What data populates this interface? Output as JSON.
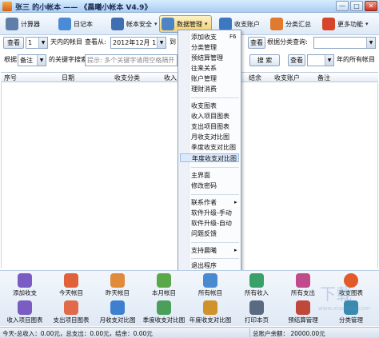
{
  "window": {
    "title": "张三 的小帐本 —— 《晨曦小帐本 V4.9》",
    "controls": [
      "—",
      "□",
      "✕"
    ]
  },
  "toolbar": {
    "items": [
      {
        "label": "计算器",
        "icon": "calculator-icon",
        "color": "#5f7fa8"
      },
      {
        "label": "日记本",
        "icon": "notebook-icon",
        "color": "#4b8bd6"
      },
      {
        "label": "帐本安全",
        "icon": "shield-icon",
        "color": "#3f6fb0"
      },
      {
        "label": "数据管理",
        "icon": "database-icon",
        "color": "#4d84c8"
      },
      {
        "label": "收支账户",
        "icon": "account-icon",
        "color": "#3c78c0"
      },
      {
        "label": "分类汇总",
        "icon": "summary-icon",
        "color": "#e07a2e"
      },
      {
        "label": "更多功能",
        "icon": "more-icon",
        "color": "#d6452a"
      }
    ]
  },
  "filter": {
    "query_button": "查看",
    "days_value": "1",
    "days_suffix": "天内的帐目",
    "view_from_label": "查看从:",
    "date_from": "2012年12月 1日",
    "to_label": "到",
    "category_label": "根据分类查询:",
    "category_value": "",
    "query_button2": "查看",
    "by_label": "根据",
    "by_value": "备注",
    "keyword_label": "的关键字搜索:",
    "keyword_placeholder": "提示: 多个关键字请用空格隔开",
    "search_button": "搜 索",
    "view_button3": "查看",
    "year_value": "",
    "year_suffix": "年的所有帐目"
  },
  "table": {
    "columns": [
      "序号",
      "日期",
      "收支分类",
      "收入",
      "结余",
      "收支账户",
      "备注"
    ]
  },
  "menu": {
    "items": [
      {
        "label": "添加收支",
        "shortcut": "F6"
      },
      {
        "label": "分类管理"
      },
      {
        "label": "预结算管理"
      },
      {
        "label": "往来关系"
      },
      {
        "label": "账户管理"
      },
      {
        "label": "理财消费"
      },
      {
        "sep": true
      },
      {
        "label": "收支图表"
      },
      {
        "label": "收入项目图表"
      },
      {
        "label": "支出项目图表"
      },
      {
        "label": "月收支对比图"
      },
      {
        "label": "季度收支对比图"
      },
      {
        "label": "年度收支对比图",
        "highlighted": true
      },
      {
        "sep": true
      },
      {
        "label": "主界面"
      },
      {
        "label": "修改密码"
      },
      {
        "sep": true
      },
      {
        "label": "联系作者",
        "submenu": "▸"
      },
      {
        "label": "软件升级-手动"
      },
      {
        "label": "软件升级-自动"
      },
      {
        "label": "问题反馈"
      },
      {
        "sep": true
      },
      {
        "label": "支持晨曦",
        "submenu": "▸"
      },
      {
        "sep": true
      },
      {
        "label": "退出程序"
      }
    ]
  },
  "bottom": {
    "row1": [
      {
        "label": "添加收支",
        "icon": "add-entry-icon",
        "color": "#7a5cc2"
      },
      {
        "label": "今天帐目",
        "icon": "today-icon",
        "color": "#e0623a"
      },
      {
        "label": "昨天帐目",
        "icon": "yesterday-icon",
        "color": "#e08a3a"
      },
      {
        "label": "本月帐目",
        "icon": "month-icon",
        "color": "#5aa84a"
      },
      {
        "label": "所有帐目",
        "icon": "all-entries-icon",
        "color": "#4a8ad0"
      },
      {
        "label": "所有收入",
        "icon": "income-icon",
        "color": "#3aa06a"
      },
      {
        "label": "所有支出",
        "icon": "expense-icon",
        "color": "#c04a8a"
      },
      {
        "label": "收支图表",
        "icon": "pie-chart-icon",
        "color": "#e05a2a"
      }
    ],
    "row2": [
      {
        "label": "收入项目图表",
        "icon": "income-chart-icon",
        "color": "#7a5cc2"
      },
      {
        "label": "支出项目图表",
        "icon": "expense-chart-icon",
        "color": "#e06a4a"
      },
      {
        "label": "月收支对比图",
        "icon": "month-compare-icon",
        "color": "#3f7fd0"
      },
      {
        "label": "季度收支对比图",
        "icon": "quarter-compare-icon",
        "color": "#4aa05a"
      },
      {
        "label": "年度收支对比图",
        "icon": "year-compare-icon",
        "color": "#d0922a"
      },
      {
        "label": "打印本页",
        "icon": "print-icon",
        "color": "#5a6a80"
      },
      {
        "label": "预结算管理",
        "icon": "budget-icon",
        "color": "#c0483a"
      },
      {
        "label": "分类管理",
        "icon": "category-icon",
        "color": "#3a8ab0"
      }
    ]
  },
  "status": {
    "totals": "今天-总收入：0.00元，总支出：0.00元，结余：0.00元",
    "balance": "总账户余额：  20000.00元"
  },
  "watermark": {
    "big": "下载",
    "small": "www.xiazaiba.com"
  }
}
